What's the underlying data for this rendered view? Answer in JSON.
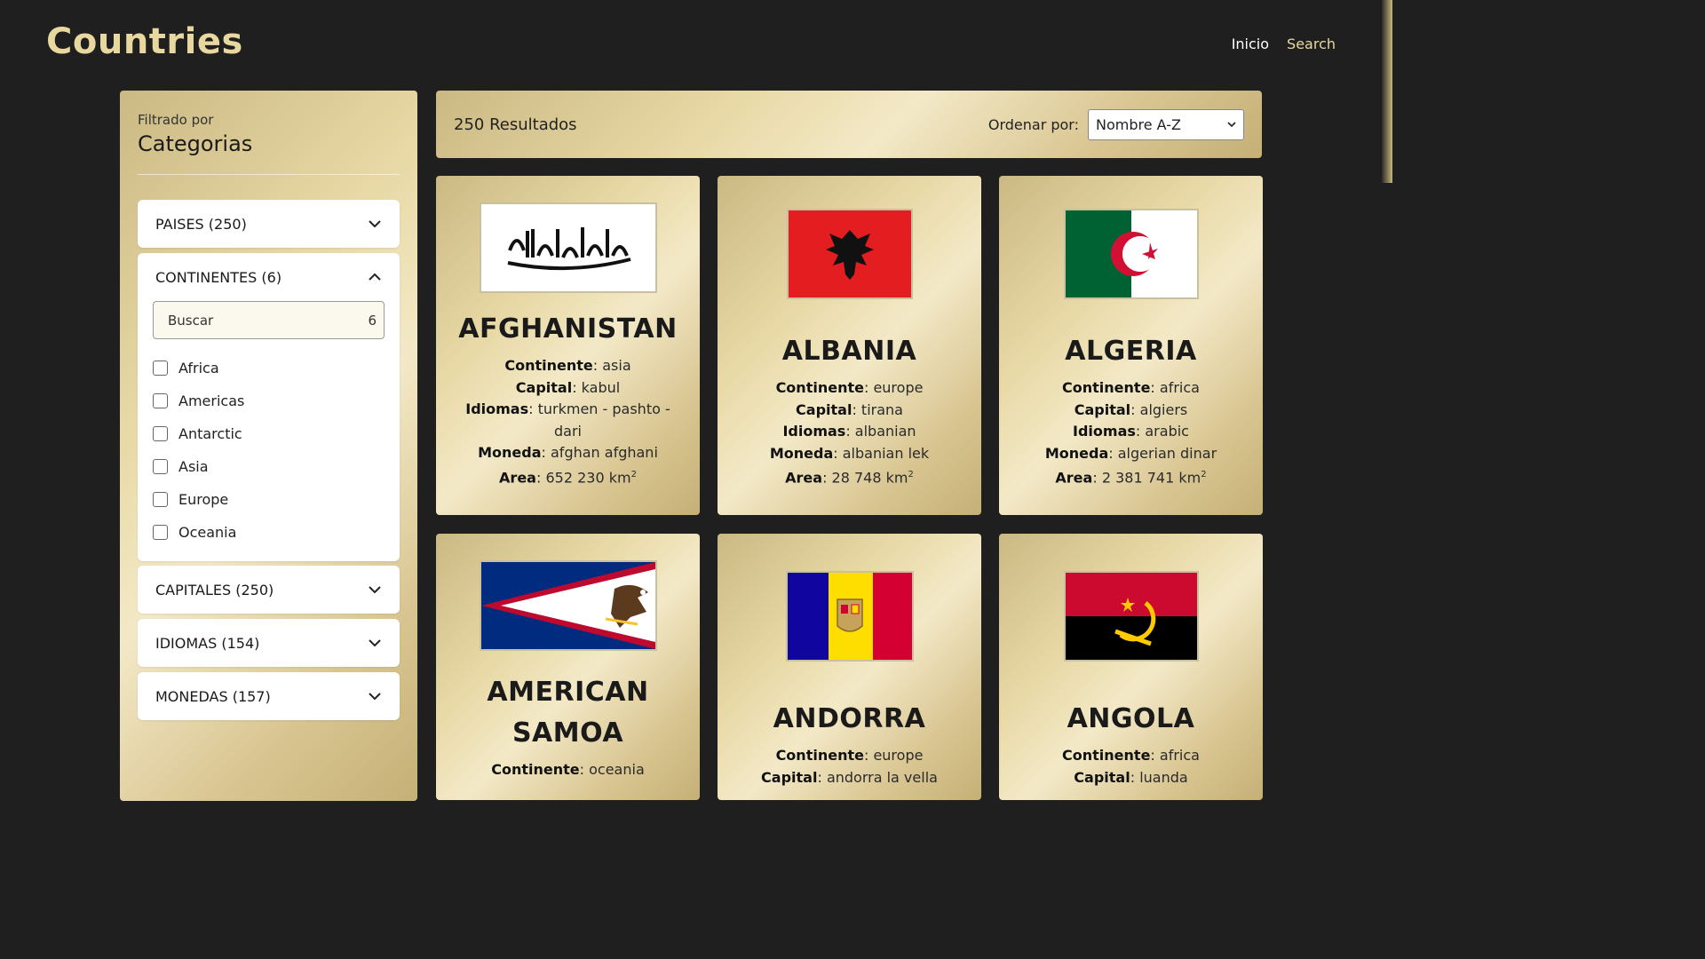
{
  "header": {
    "logo": "Countries",
    "nav": {
      "inicio": "Inicio",
      "search": "Search"
    }
  },
  "sidebar": {
    "filtered_by": "Filtrado por",
    "title": "Categorias",
    "accordions": [
      {
        "label": "PAISES (250)"
      },
      {
        "label": "CONTINENTES (6)"
      },
      {
        "label": "CAPITALES (250)"
      },
      {
        "label": "IDIOMAS (154)"
      },
      {
        "label": "MONEDAS (157)"
      }
    ],
    "continent_search": {
      "placeholder": "Buscar",
      "count": "6"
    },
    "continents": [
      "Africa",
      "Americas",
      "Antarctic",
      "Asia",
      "Europe",
      "Oceania"
    ]
  },
  "topbar": {
    "results": "250 Resultados",
    "sort_label": "Ordenar por:",
    "sort_value": "Nombre A-Z"
  },
  "labels": {
    "continent": "Continente",
    "capital": "Capital",
    "languages": "Idiomas",
    "currency": "Moneda",
    "area": "Area",
    "area_unit": "km",
    "area_exp": "2"
  },
  "cards": [
    {
      "name": "AFGHANISTAN",
      "continent": "asia",
      "capital": "kabul",
      "languages": "turkmen - pashto - dari",
      "currency": "afghan afghani",
      "area": "652 230"
    },
    {
      "name": "ALBANIA",
      "continent": "europe",
      "capital": "tirana",
      "languages": "albanian",
      "currency": "albanian lek",
      "area": "28 748"
    },
    {
      "name": "ALGERIA",
      "continent": "africa",
      "capital": "algiers",
      "languages": "arabic",
      "currency": "algerian dinar",
      "area": "2 381 741"
    },
    {
      "name": "AMERICAN SAMOA",
      "continent": "oceania"
    },
    {
      "name": "ANDORRA",
      "continent": "europe",
      "capital": "andorra la vella"
    },
    {
      "name": "ANGOLA",
      "continent": "africa",
      "capital": "luanda"
    }
  ],
  "colors": {
    "background": "#1f1f1f",
    "logo": "#e9d7a0",
    "gold_light": "#f3e9c7",
    "gold_dark": "#c5b076"
  }
}
